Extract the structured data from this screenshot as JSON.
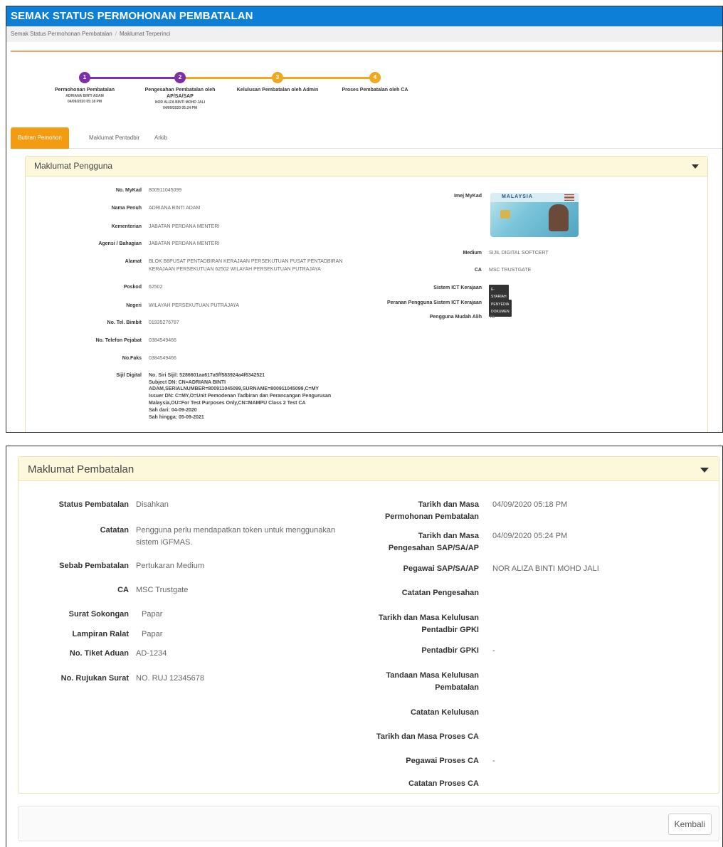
{
  "header": {
    "title": "SEMAK STATUS PERMOHONAN PEMBATALAN"
  },
  "breadcrumb": {
    "items": [
      "Semak Status Permohonan Pembatalan",
      "Maklumat Terperinci"
    ],
    "separator": "/"
  },
  "stepper": {
    "steps": [
      {
        "number": "1",
        "title": "Permohonan Pembatalan",
        "sub1": "ADRIANA BINTI ADAM",
        "sub2": "04/09/2020 05:18 PM",
        "state": "done",
        "color": "#7b2fa8"
      },
      {
        "number": "2",
        "title": "Pengesahan Pembatalan oleh AP/SA/SAP",
        "sub1": "NOR ALIZA BINTI MOHD JALI",
        "sub2": "04/09/2020 05:24 PM",
        "state": "done",
        "color": "#7b2fa8"
      },
      {
        "number": "3",
        "title": "Kelulusan Pembatalan oleh Admin",
        "sub1": "",
        "sub2": "",
        "state": "pending",
        "color": "#f0a81e"
      },
      {
        "number": "4",
        "title": "Proses Pembatalan oleh CA",
        "sub1": "",
        "sub2": "",
        "state": "pending",
        "color": "#f0a81e"
      }
    ]
  },
  "tabs": [
    {
      "label": "Butiran Pemohon",
      "active": true
    },
    {
      "label": "Maklumat Pentadbir",
      "active": false
    },
    {
      "label": "Arkib",
      "active": false
    }
  ],
  "pengguna": {
    "heading": "Maklumat Pengguna",
    "left": [
      {
        "label": "No. MyKad",
        "value": "800911045099"
      },
      {
        "label": "Nama Penuh",
        "value": "ADRIANA BINTI ADAM"
      },
      {
        "label": "Kementerian",
        "value": "JABATAN PERDANA MENTERI"
      },
      {
        "label": "Agensi / Bahagian",
        "value": "JABATAN PERDANA MENTERI"
      },
      {
        "label": "Alamat",
        "value": "BLOK B8PUSAT PENTADBIRAN KERAJAAN PERSEKUTUAN PUSAT PENTADBIRAN",
        "value2": "KERAJAAN PERSEKUTUAN 62502 WILAYAH PERSEKUTUAN PUTRAJAYA"
      },
      {
        "label": "Poskod",
        "value": "62502"
      },
      {
        "label": "Negeri",
        "value": "WILAYAH PERSEKUTUAN PUTRAJAYA"
      },
      {
        "label": "No. Tel. Bimbit",
        "value": "01935276787"
      },
      {
        "label": "No. Telefon Pejabat",
        "value": "0384549466"
      },
      {
        "label": "No.Faks",
        "value": "0384549466"
      }
    ],
    "siji": {
      "label": "Sijil Digital",
      "lines": [
        "No. Siri Sijil: 5286601aa617a5ff583924a4f6342521",
        "Subject DN: CN=ADRIANA BINTI",
        "ADAM,SERIALNUMBER=800911045099,SURNAME=800911045099,C=MY",
        "Issuer DN: C=MY,O=Unit Pemodenan Tadbiran dan Perancangan Pengurusan",
        "Malaysia,OU=For Test Purposes Only,CN=MAMPU Class 2 Test CA",
        "Sah dari: 04-09-2020",
        "Sah hingga: 05-09-2021"
      ]
    },
    "right": {
      "imej_label": "Imej MyKad",
      "mykad_text": "MALAYSIA",
      "medium_label": "Medium",
      "medium_value": "SIJIL DIGITAL SOFTCERT",
      "ca_label": "CA",
      "ca_value": "MSC TRUSTGATE",
      "sistem_label": "Sistem ICT Kerajaan",
      "sistem_value": "E-SYARIAH",
      "peranan_label": "Peranan Pengguna Sistem ICT Kerajaan",
      "peranan_value": "PENYEDIA DOKUMEN",
      "mudah_label": "Pengguna Mudah Alih",
      "mudah_value": "Ya"
    }
  },
  "pembatalan": {
    "heading": "Maklumat Pembatalan",
    "left": {
      "status_label": "Status Pembatalan",
      "status_value": "Disahkan",
      "catatan_label": "Catatan",
      "catatan_value1": "Pengguna perlu mendapatkan token untuk menggunakan",
      "catatan_value2": "sistem iGFMAS.",
      "sebab_label": "Sebab Pembatalan",
      "sebab_value": "Pertukaran Medium",
      "ca_label": "CA",
      "ca_value": "MSC Trustgate",
      "surat_label": "Surat Sokongan",
      "surat_value": "Papar",
      "lampiran_label": "Lampiran Ralat",
      "lampiran_value": "Papar",
      "tiket_label": "No. Tiket Aduan",
      "tiket_value": "AD-1234",
      "rujukan_label": "No. Rujukan Surat",
      "rujukan_value": "NO. RUJ 12345678"
    },
    "right": {
      "tm_mohon_label1": "Tarikh dan Masa",
      "tm_mohon_label2": "Permohonan Pembatalan",
      "tm_mohon_value": "04/09/2020 05:18 PM",
      "tm_sah_label1": "Tarikh dan Masa",
      "tm_sah_label2": "Pengesahan SAP/SA/AP",
      "tm_sah_value": "04/09/2020 05:24 PM",
      "pegawai_label": "Pegawai SAP/SA/AP",
      "pegawai_value": "NOR ALIZA BINTI MOHD JALI",
      "catatan_sah_label": "Catatan Pengesahan",
      "tm_lulus_label1": "Tarikh dan Masa Kelulusan",
      "tm_lulus_label2": "Pentadbir GPKI",
      "pentadbir_label": "Pentadbir GPKI",
      "pentadbir_value": "-",
      "tandaan_label1": "Tandaan Masa Kelulusan",
      "tandaan_label2": "Pembatalan",
      "catatan_lulus_label": "Catatan Kelulusan",
      "tm_proses_label": "Tarikh dan Masa Proses CA",
      "pegawai_proses_label": "Pegawai Proses CA",
      "pegawai_proses_value": "-",
      "catatan_proses_label": "Catatan Proses CA"
    }
  },
  "footer": {
    "back_label": "Kembali"
  }
}
